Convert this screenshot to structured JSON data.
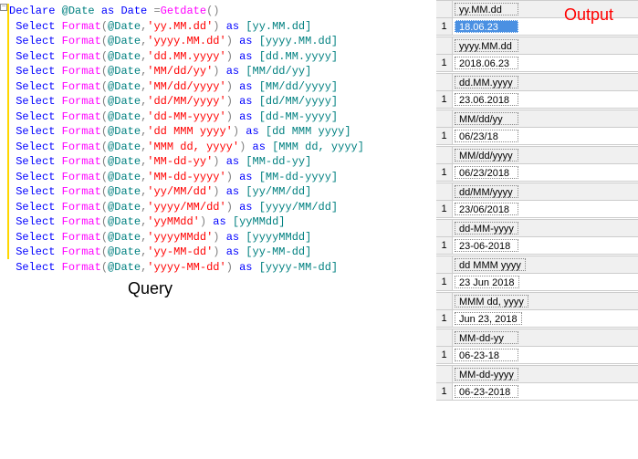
{
  "code": {
    "declare": "Declare",
    "atDate": "@Date",
    "as": "as",
    "dateType": "Date",
    "eq": "=",
    "getdate": "Getdate",
    "select": "Select",
    "format": "Format",
    "lines": [
      {
        "fmt": "'yy.MM.dd'",
        "alias": "[yy.MM.dd]"
      },
      {
        "fmt": "'yyyy.MM.dd'",
        "alias": "[yyyy.MM.dd]"
      },
      {
        "fmt": "'dd.MM.yyyy'",
        "alias": "[dd.MM.yyyy]"
      },
      {
        "fmt": "'MM/dd/yy'",
        "alias": "[MM/dd/yy]"
      },
      {
        "fmt": "'MM/dd/yyyy'",
        "alias": "[MM/dd/yyyy]"
      },
      {
        "fmt": "'dd/MM/yyyy'",
        "alias": "[dd/MM/yyyy]"
      },
      {
        "fmt": "'dd-MM-yyyy'",
        "alias": "[dd-MM-yyyy]"
      },
      {
        "fmt": "'dd MMM yyyy'",
        "alias": "[dd MMM yyyy]"
      },
      {
        "fmt": "'MMM dd, yyyy'",
        "alias": "[MMM dd, yyyy]"
      },
      {
        "fmt": "'MM-dd-yy'",
        "alias": "[MM-dd-yy]"
      },
      {
        "fmt": "'MM-dd-yyyy'",
        "alias": "[MM-dd-yyyy]"
      },
      {
        "fmt": "'yy/MM/dd'",
        "alias": "[yy/MM/dd]"
      },
      {
        "fmt": "'yyyy/MM/dd'",
        "alias": "[yyyy/MM/dd]"
      },
      {
        "fmt": "'yyMMdd'",
        "alias": "[yyMMdd]"
      },
      {
        "fmt": "'yyyyMMdd'",
        "alias": "[yyyyMMdd]"
      },
      {
        "fmt": "'yy-MM-dd'",
        "alias": "[yy-MM-dd]"
      },
      {
        "fmt": "'yyyy-MM-dd'",
        "alias": "[yyyy-MM-dd]"
      }
    ]
  },
  "labels": {
    "query": "Query",
    "output": "Output"
  },
  "results": [
    {
      "header": "yy.MM.dd",
      "value": "18.06.23",
      "selected": true
    },
    {
      "header": "yyyy.MM.dd",
      "value": "2018.06.23"
    },
    {
      "header": "dd.MM.yyyy",
      "value": "23.06.2018"
    },
    {
      "header": "MM/dd/yy",
      "value": "06/23/18"
    },
    {
      "header": "MM/dd/yyyy",
      "value": "06/23/2018"
    },
    {
      "header": "dd/MM/yyyy",
      "value": "23/06/2018"
    },
    {
      "header": "dd-MM-yyyy",
      "value": "23-06-2018"
    },
    {
      "header": "dd MMM yyyy",
      "value": "23 Jun 2018"
    },
    {
      "header": "MMM dd, yyyy",
      "value": "Jun 23, 2018"
    },
    {
      "header": "MM-dd-yy",
      "value": "06-23-18"
    },
    {
      "header": "MM-dd-yyyy",
      "value": "06-23-2018"
    }
  ],
  "rownum": "1"
}
